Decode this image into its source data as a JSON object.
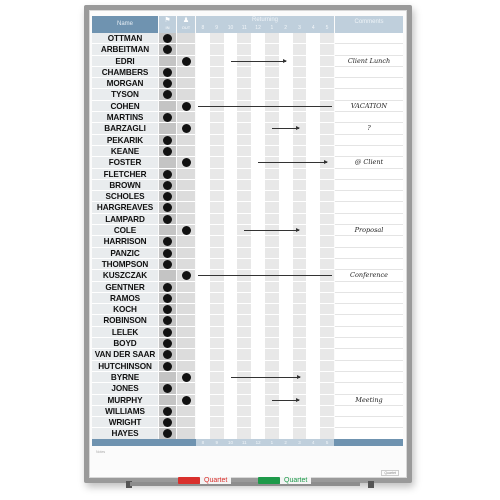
{
  "header": {
    "name_label": "Name",
    "in_label": "IN",
    "out_label": "OUT",
    "returning_label": "Returning",
    "comments_label": "Comments",
    "hours": [
      "8",
      "9",
      "10",
      "11",
      "12",
      "1",
      "2",
      "3",
      "4",
      "5"
    ]
  },
  "rows": [
    {
      "name": "OTTMAN",
      "status": "in",
      "comment": ""
    },
    {
      "name": "ARBEITMAN",
      "status": "in",
      "comment": ""
    },
    {
      "name": "EDRI",
      "status": "out",
      "comment": "Client Lunch",
      "return_arrow": {
        "from_hour": "10",
        "to_hour": "2"
      }
    },
    {
      "name": "CHAMBERS",
      "status": "in",
      "comment": ""
    },
    {
      "name": "MORGAN",
      "status": "in",
      "comment": ""
    },
    {
      "name": "TYSON",
      "status": "in",
      "comment": ""
    },
    {
      "name": "COHEN",
      "status": "out",
      "comment": "VACATION",
      "return_arrow": {
        "from_hour": "8",
        "to_hour": "5"
      }
    },
    {
      "name": "MARTINS",
      "status": "in",
      "comment": ""
    },
    {
      "name": "BARZAGLI",
      "status": "out",
      "comment": "?",
      "return_arrow": {
        "from_hour": "1",
        "to_hour": "3"
      }
    },
    {
      "name": "PEKARIK",
      "status": "in",
      "comment": ""
    },
    {
      "name": "KEANE",
      "status": "in",
      "comment": ""
    },
    {
      "name": "FOSTER",
      "status": "out",
      "comment": "@ Client",
      "return_arrow": {
        "from_hour": "12",
        "to_hour": "5"
      }
    },
    {
      "name": "FLETCHER",
      "status": "in",
      "comment": ""
    },
    {
      "name": "BROWN",
      "status": "in",
      "comment": ""
    },
    {
      "name": "SCHOLES",
      "status": "in",
      "comment": ""
    },
    {
      "name": "HARGREAVES",
      "status": "in",
      "comment": ""
    },
    {
      "name": "LAMPARD",
      "status": "in",
      "comment": ""
    },
    {
      "name": "COLE",
      "status": "out",
      "comment": "Proposal",
      "return_arrow": {
        "from_hour": "11",
        "to_hour": "3"
      }
    },
    {
      "name": "HARRISON",
      "status": "in",
      "comment": ""
    },
    {
      "name": "PANZIC",
      "status": "in",
      "comment": ""
    },
    {
      "name": "THOMPSON",
      "status": "in",
      "comment": ""
    },
    {
      "name": "KUSZCZAK",
      "status": "out",
      "comment": "Conference",
      "return_arrow": {
        "from_hour": "8",
        "to_hour": "5"
      }
    },
    {
      "name": "GENTNER",
      "status": "in",
      "comment": ""
    },
    {
      "name": "RAMOS",
      "status": "in",
      "comment": ""
    },
    {
      "name": "KOCH",
      "status": "in",
      "comment": ""
    },
    {
      "name": "ROBINSON",
      "status": "in",
      "comment": ""
    },
    {
      "name": "LELEK",
      "status": "in",
      "comment": ""
    },
    {
      "name": "BOYD",
      "status": "in",
      "comment": ""
    },
    {
      "name": "VAN DER SAAR",
      "status": "in",
      "comment": ""
    },
    {
      "name": "HUTCHINSON",
      "status": "in",
      "comment": ""
    },
    {
      "name": "BYRNE",
      "status": "out",
      "comment": "",
      "return_arrow": {
        "from_hour": "10",
        "to_hour": "3"
      }
    },
    {
      "name": "JONES",
      "status": "in",
      "comment": ""
    },
    {
      "name": "MURPHY",
      "status": "out",
      "comment": "Meeting",
      "return_arrow": {
        "from_hour": "1",
        "to_hour": "3"
      }
    },
    {
      "name": "WILLIAMS",
      "status": "in",
      "comment": ""
    },
    {
      "name": "WRIGHT",
      "status": "in",
      "comment": ""
    },
    {
      "name": "HAYES",
      "status": "in",
      "comment": ""
    }
  ],
  "footer": {
    "notes_label": "Notes",
    "brand_badge": "Quartet"
  },
  "markers": [
    {
      "label": "Quartet",
      "color": "#d9302c",
      "text_color": "#d9302c"
    },
    {
      "label": "Quartet",
      "color": "#1e9a4a",
      "text_color": "#1e9a4a"
    }
  ],
  "colors": {
    "header_blue": "#6f93b0",
    "header_light": "#bfcfdc",
    "frame": "#9a9a9a"
  }
}
